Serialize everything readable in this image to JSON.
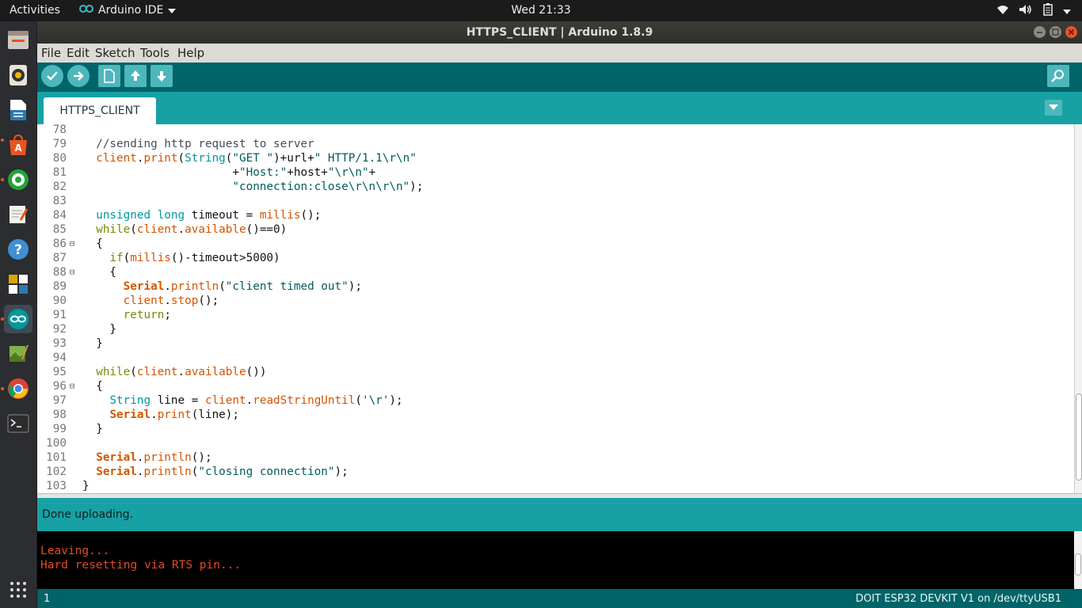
{
  "topbar": {
    "activities": "Activities",
    "app_name": "Arduino IDE",
    "clock": "Wed 21:33",
    "tray_icons": [
      "wifi-icon",
      "volume-icon",
      "battery-icon",
      "system-menu-arrow-icon"
    ]
  },
  "dock": {
    "items": [
      "files",
      "rhythmbox",
      "libreoffice-writer",
      "ubuntu-software",
      "whatsapp",
      "text-editor",
      "help",
      "app-launcher-grid",
      "arduino",
      "image-editor",
      "chrome",
      "terminal",
      "show-applications"
    ]
  },
  "window": {
    "title": "HTTPS_CLIENT | Arduino 1.8.9"
  },
  "menu": [
    "File",
    "Edit",
    "Sketch",
    "Tools",
    "Help"
  ],
  "toolbar": {
    "buttons": [
      "Verify",
      "Upload",
      "New",
      "Open",
      "Save",
      "Serial Monitor"
    ]
  },
  "tab": {
    "label": "HTTPS_CLIENT"
  },
  "code": [
    {
      "n": "78",
      "t": ""
    },
    {
      "n": "79",
      "t": "  //sending http request to server"
    },
    {
      "n": "80",
      "t": "  client.print(String(\"GET \")+url+\" HTTP/1.1\\r\\n\""
    },
    {
      "n": "81",
      "t": "                      +\"Host:\"+host+\"\\r\\n\"+"
    },
    {
      "n": "82",
      "t": "                      \"connection:close\\r\\n\\r\\n\");"
    },
    {
      "n": "83",
      "t": ""
    },
    {
      "n": "84",
      "t": "  unsigned long timeout = millis();"
    },
    {
      "n": "85",
      "t": "  while(client.available()==0)"
    },
    {
      "n": "86",
      "t": "  {",
      "fold": true
    },
    {
      "n": "87",
      "t": "    if(millis()-timeout>5000)"
    },
    {
      "n": "88",
      "t": "    {",
      "fold": true
    },
    {
      "n": "89",
      "t": "      Serial.println(\"client timed out\");"
    },
    {
      "n": "90",
      "t": "      client.stop();"
    },
    {
      "n": "91",
      "t": "      return;"
    },
    {
      "n": "92",
      "t": "    }"
    },
    {
      "n": "93",
      "t": "  }"
    },
    {
      "n": "94",
      "t": ""
    },
    {
      "n": "95",
      "t": "  while(client.available())"
    },
    {
      "n": "96",
      "t": "  {",
      "fold": true
    },
    {
      "n": "97",
      "t": "    String line = client.readStringUntil('\\r');"
    },
    {
      "n": "98",
      "t": "    Serial.print(line);"
    },
    {
      "n": "99",
      "t": "  }"
    },
    {
      "n": "100",
      "t": ""
    },
    {
      "n": "101",
      "t": "  Serial.println();"
    },
    {
      "n": "102",
      "t": "  Serial.println(\"closing connection\");"
    },
    {
      "n": "103",
      "t": "}"
    }
  ],
  "status": {
    "message": "Done uploading."
  },
  "console": {
    "lines": [
      "Leaving...",
      "Hard resetting via RTS pin..."
    ]
  },
  "footer": {
    "line_number": "1",
    "board": "DOIT ESP32 DEVKIT V1  on /dev/ttyUSB1"
  },
  "colors": {
    "toolbar": "#006468",
    "accent": "#17a1a5",
    "console_text": "#e34c22",
    "keyword": "#00979c",
    "function": "#d35400"
  }
}
